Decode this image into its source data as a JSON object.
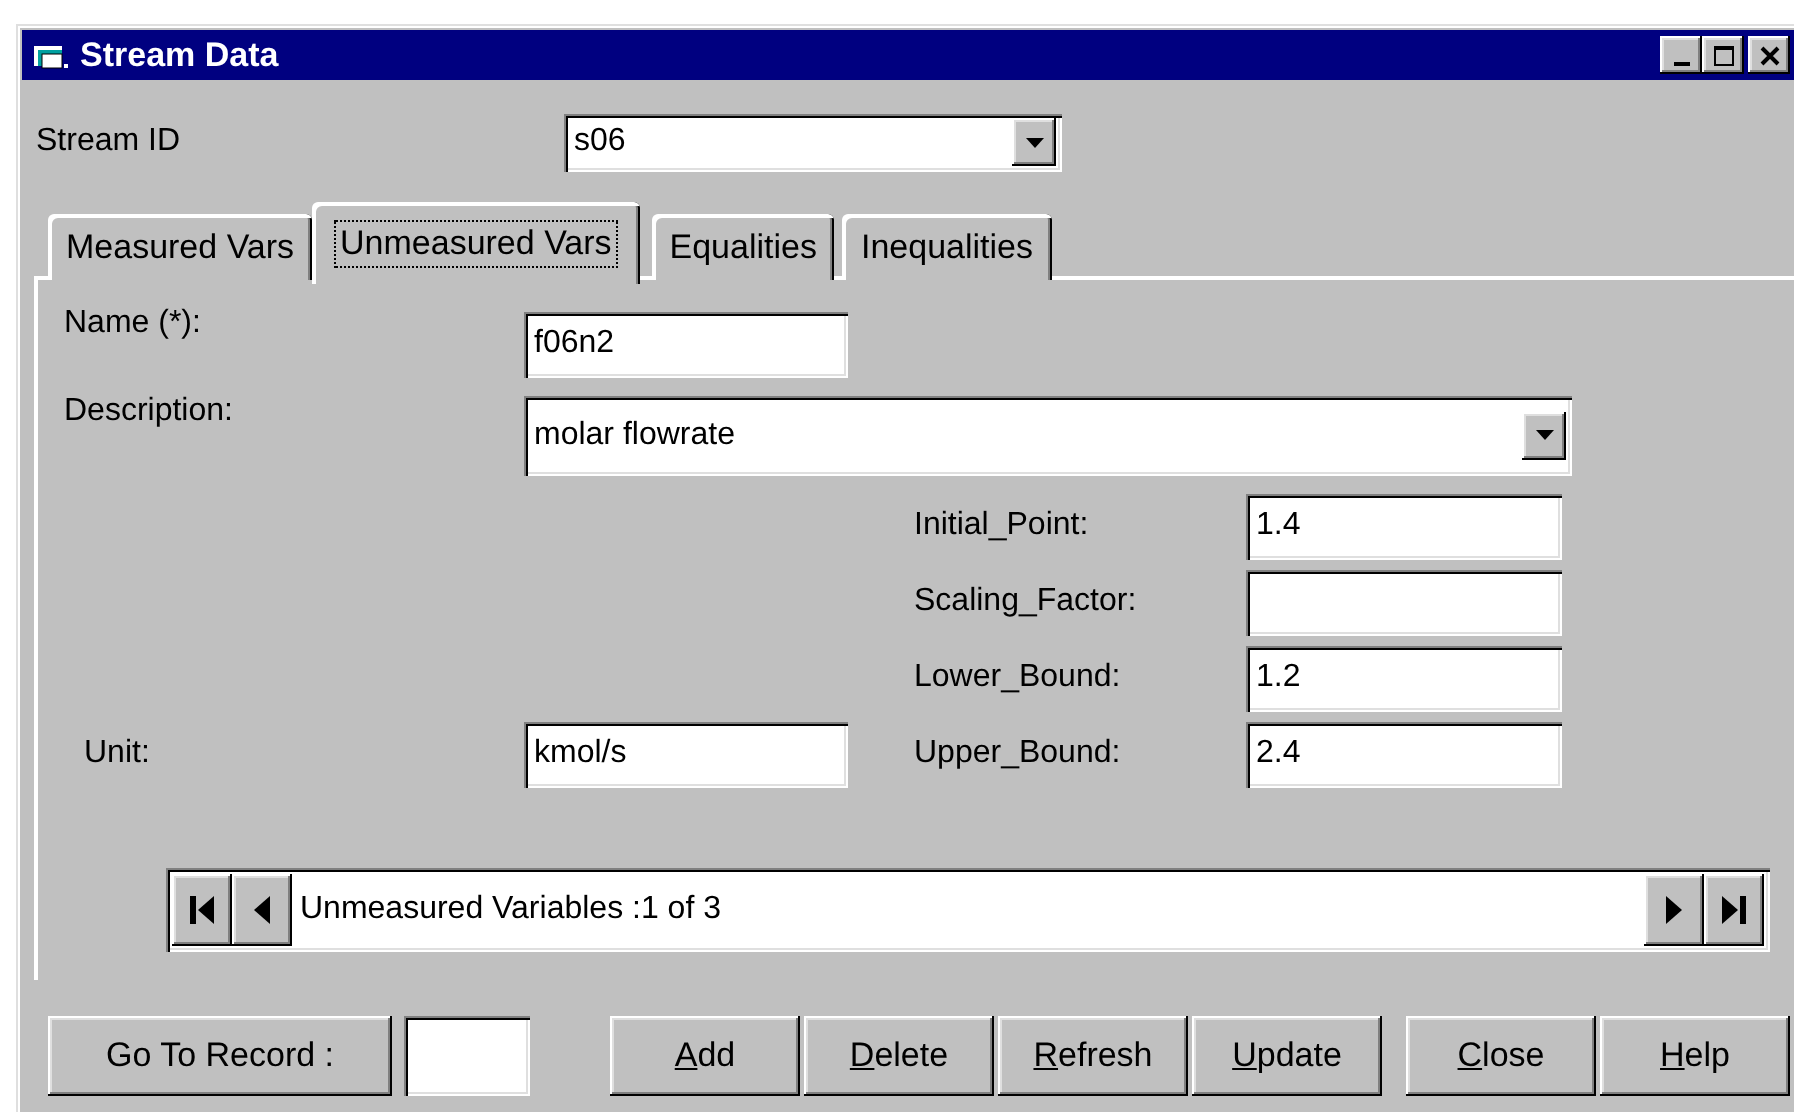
{
  "window": {
    "title": "Stream Data"
  },
  "stream_id": {
    "label": "Stream ID",
    "value": "s06"
  },
  "tabs": [
    {
      "label": "Measured Vars",
      "selected": false
    },
    {
      "label": "Unmeasured Vars",
      "selected": true
    },
    {
      "label": "Equalities",
      "selected": false
    },
    {
      "label": "Inequalities",
      "selected": false
    }
  ],
  "form": {
    "name": {
      "label": "Name (*):",
      "value": "f06n2"
    },
    "description": {
      "label": "Description:",
      "value": "molar flowrate"
    },
    "unit": {
      "label": "Unit:",
      "value": "kmol/s"
    },
    "bounds": [
      {
        "label": "Initial_Point:",
        "value": "1.4"
      },
      {
        "label": "Scaling_Factor:"
      },
      {
        "label": "Lower_Bound:",
        "value": "1.2"
      },
      {
        "label": "Upper_Bound:",
        "value": "2.4"
      }
    ]
  },
  "navigator": {
    "text": "Unmeasured Variables :1 of 3"
  },
  "go_to_record": {
    "label": "Go To Record :"
  },
  "buttons": [
    {
      "label": "Add",
      "first_letter_underlined": true
    },
    {
      "label": "Delete",
      "first_letter_underlined": true
    },
    {
      "label": "Refresh",
      "first_letter_underlined": true
    },
    {
      "label": "Update",
      "first_letter_underlined": true
    },
    {
      "label": "Close",
      "first_letter_underlined": true
    },
    {
      "label": "Help",
      "first_letter_underlined": true
    }
  ]
}
